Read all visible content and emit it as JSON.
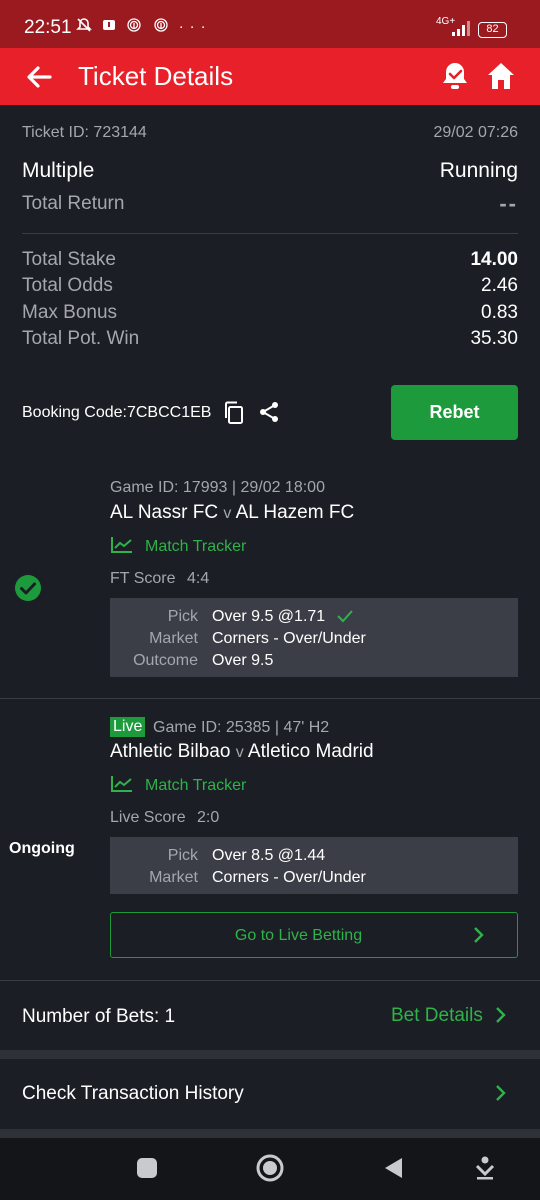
{
  "status_bar": {
    "time": "22:51",
    "icons": [
      "mute-icon",
      "message-icon",
      "fingerprint-icon",
      "fingerprint-icon",
      "more-icon"
    ],
    "network": "4G+",
    "battery": "82"
  },
  "header": {
    "title": "Ticket Details"
  },
  "ticket": {
    "id_label": "Ticket ID: 723144",
    "datetime": "29/02 07:26",
    "type": "Multiple",
    "status": "Running",
    "total_return_label": "Total Return",
    "total_return_value": "--",
    "stats": [
      {
        "label": "Total Stake",
        "value": "14.00"
      },
      {
        "label": "Total Odds",
        "value": "2.46"
      },
      {
        "label": "Max Bonus",
        "value": "0.83"
      },
      {
        "label": "Total Pot. Win",
        "value": "35.30"
      }
    ],
    "booking_code": "Booking Code:7CBCC1EB",
    "rebet_label": "Rebet"
  },
  "bets": [
    {
      "meta": "Game ID: 17993 | 29/02 18:00",
      "home": "AL Nassr FC",
      "vs": "v",
      "away": "AL Hazem FC",
      "tracker": "Match Tracker",
      "score_label": "FT Score",
      "score": "4:4",
      "pick_label": "Pick",
      "pick": "Over 9.5 @1.71",
      "market_label": "Market",
      "market": "Corners - Over/Under",
      "outcome_label": "Outcome",
      "outcome": "Over 9.5",
      "result_state": "won"
    },
    {
      "live_badge": "Live",
      "meta": "Game ID: 25385 | 47' H2",
      "home": "Athletic Bilbao",
      "vs": "v",
      "away": "Atletico Madrid",
      "tracker": "Match Tracker",
      "score_label": "Live Score",
      "score": "2:0",
      "pick_label": "Pick",
      "pick": "Over 8.5 @1.44",
      "market_label": "Market",
      "market": "Corners - Over/Under",
      "state_label": "Ongoing",
      "live_betting_label": "Go to Live Betting"
    }
  ],
  "footer": {
    "number_of_bets": "Number of Bets: 1",
    "bet_details": "Bet Details",
    "transaction_history": "Check Transaction History"
  },
  "colors": {
    "brand_red": "#e8202a",
    "accent_green": "#1d9a3c",
    "background": "#1b1e24"
  }
}
